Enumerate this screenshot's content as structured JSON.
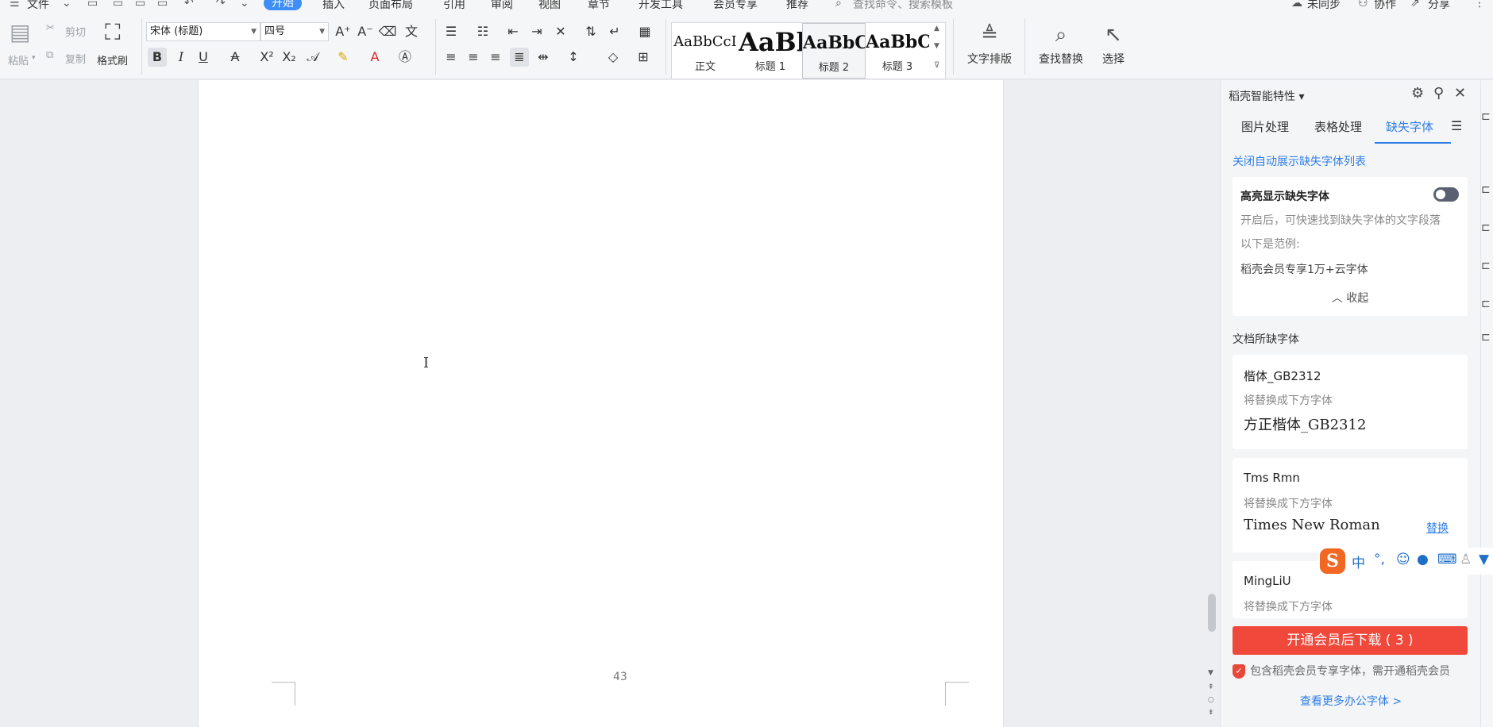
{
  "menubar": {
    "file": "文件",
    "tabs": [
      "开始",
      "插入",
      "页面布局",
      "引用",
      "审阅",
      "视图",
      "章节",
      "开发工具",
      "会员专享",
      "推荐"
    ],
    "active_tab": "开始",
    "search": "查找命令、搜索模板",
    "sync": "未同步",
    "collab": "协作",
    "share": "分享"
  },
  "ribbon": {
    "paste": "粘贴",
    "cut": "剪切",
    "copy": "复制",
    "format_painter": "格式刷",
    "font_name": "宋体 (标题)",
    "font_size": "四号",
    "styles": [
      {
        "preview": "AaBbCcI",
        "name": "正文"
      },
      {
        "preview": "AaBl",
        "name": "标题 1"
      },
      {
        "preview": "AaBbC",
        "name": "标题 2"
      },
      {
        "preview": "AaBbC",
        "name": "标题 3"
      }
    ],
    "text_layout": "文字排版",
    "find_replace": "查找替换",
    "select": "选择"
  },
  "document": {
    "page_number": "43"
  },
  "panel": {
    "title": "稻壳智能特性",
    "tabs": [
      "图片处理",
      "表格处理",
      "缺失字体"
    ],
    "active_tab": "缺失字体",
    "auto_link": "关闭自动展示缺失字体列表",
    "highlight_card": {
      "title": "高亮显示缺失字体",
      "toggle_on": false,
      "desc": "开启后，可快速找到缺失字体的文字段落",
      "example_label": "以下是范例:",
      "example_text": "稻壳会员专享1万+云字体",
      "collapse": "收起"
    },
    "section_title": "文档所缺字体",
    "replace_hint": "将替换成下方字体",
    "missing_fonts": [
      {
        "name": "楷体_GB2312",
        "replacement": "方正楷体_GB2312",
        "action": ""
      },
      {
        "name": "Tms Rmn",
        "replacement": "Times New Roman",
        "action": "替换"
      },
      {
        "name": "MingLiU",
        "replacement": "",
        "action": ""
      }
    ],
    "download_button": "开通会员后下载 ( 3 )",
    "member_note": "包含稻壳会员专享字体，需开通稻壳会员",
    "more_link": "查看更多办公字体 >"
  },
  "ime": {
    "mode": "中",
    "punct": "°,"
  },
  "colors": {
    "accent": "#2f7ee6",
    "download": "#f0483a",
    "ime": "#f26722"
  }
}
